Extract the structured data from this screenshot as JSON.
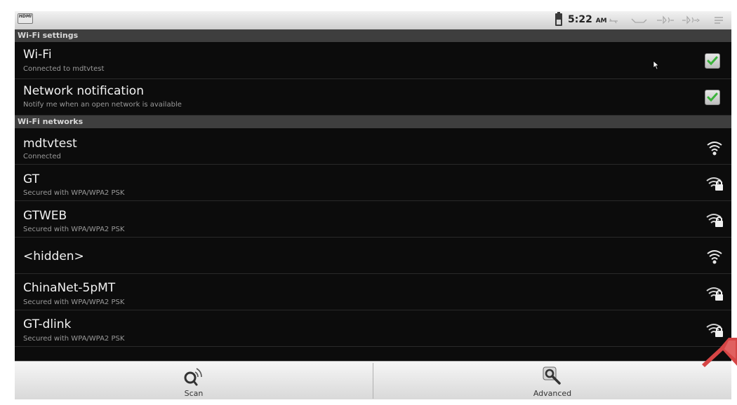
{
  "status_bar": {
    "hdmi_label": "HDMI",
    "time": "5:22",
    "ampm": "AM",
    "icons": [
      "battery-icon",
      "usb-icon",
      "sync-icon",
      "volume-down-icon",
      "volume-up-icon",
      "menu-icon"
    ]
  },
  "wifi_settings": {
    "header": "Wi-Fi settings",
    "rows": [
      {
        "title": "Wi-Fi",
        "subtitle": "Connected to mdtvtest",
        "checked": true
      },
      {
        "title": "Network notification",
        "subtitle": "Notify me when an open network is available",
        "checked": true
      }
    ]
  },
  "wifi_networks": {
    "header": "Wi-Fi networks",
    "items": [
      {
        "ssid": "mdtvtest",
        "status": "Connected",
        "secured": false
      },
      {
        "ssid": "GT",
        "status": "Secured with WPA/WPA2 PSK",
        "secured": true
      },
      {
        "ssid": "GTWEB",
        "status": "Secured with WPA/WPA2 PSK",
        "secured": true
      },
      {
        "ssid": "<hidden>",
        "status": "",
        "secured": false
      },
      {
        "ssid": "ChinaNet-5pMT",
        "status": "Secured with WPA/WPA2 PSK",
        "secured": true
      },
      {
        "ssid": "GT-dlink",
        "status": "Secured with WPA/WPA2 PSK",
        "secured": true
      },
      {
        "ssid": "",
        "status": "",
        "secured": true
      }
    ]
  },
  "bottom_bar": {
    "scan_label": "Scan",
    "advanced_label": "Advanced"
  },
  "colors": {
    "background": "#0c0c0c",
    "header": "#3e3e3e",
    "check_green": "#3bb33b"
  }
}
